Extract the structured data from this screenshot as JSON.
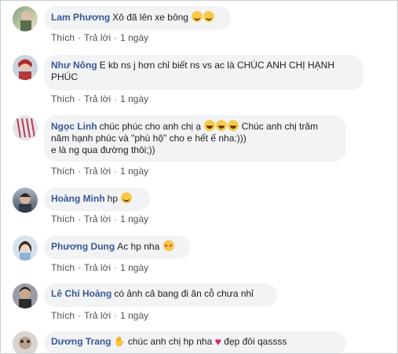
{
  "comments": [
    {
      "author": "Lam Phương",
      "text": "Xô đã lên xe bông",
      "emojis": [
        "smile-face-icon",
        "smile-face-icon"
      ],
      "like": "Thích",
      "reply": "Trả lời",
      "time": "1 ngày"
    },
    {
      "author": "Như Nông",
      "text_line1": "E kb ns j hơn chỉ biết ns vs ac là CHÚC ANH CHỊ HẠNH",
      "text_line2": "PHÚC",
      "like": "Thích",
      "reply": "Trả lời",
      "time": "1 ngày"
    },
    {
      "author": "Ngọc Linh",
      "text_line1a": "chúc phúc cho anh chị ạ",
      "text_line1b": "Chúc anh chị trăm",
      "text_line2": "năm hạnh phúc và \"phù hộ\" cho e hết ế nha:)))",
      "text_line3": "e là ng qua đường thôi;))",
      "emojis": [
        "laughing-face-icon",
        "laughing-face-icon",
        "laughing-face-icon"
      ],
      "like": "Thích",
      "reply": "Trả lời",
      "time": "1 ngày"
    },
    {
      "author": "Hoàng Minh",
      "text": "hp",
      "emojis": [
        "smiling-face-icon"
      ],
      "like": "Thích",
      "reply": "Trả lời",
      "time": "1 ngày"
    },
    {
      "author": "Phương Dung",
      "text": "Ac hp nha",
      "emojis": [
        "heart-eyes-face-icon"
      ],
      "like": "Thích",
      "reply": "Trả lời",
      "time": "1 ngày"
    },
    {
      "author": "Lê Chí Hoàng",
      "text": "có ảnh cả bang đi ăn cỗ chưa nhỉ",
      "like": "Thích",
      "reply": "Trả lời",
      "time": "1 ngày"
    },
    {
      "author": "Dương Trang",
      "text_a": "chúc anh chị hp nha",
      "text_b": "đẹp đôi qassss",
      "emojis": [
        "waving-hand-icon",
        "red-heart-icon"
      ]
    }
  ],
  "colors": {
    "author_name": "#385898",
    "bubble_bg": "#f2f3f5",
    "meta_text": "#606770",
    "border": "#c9ccd1"
  }
}
